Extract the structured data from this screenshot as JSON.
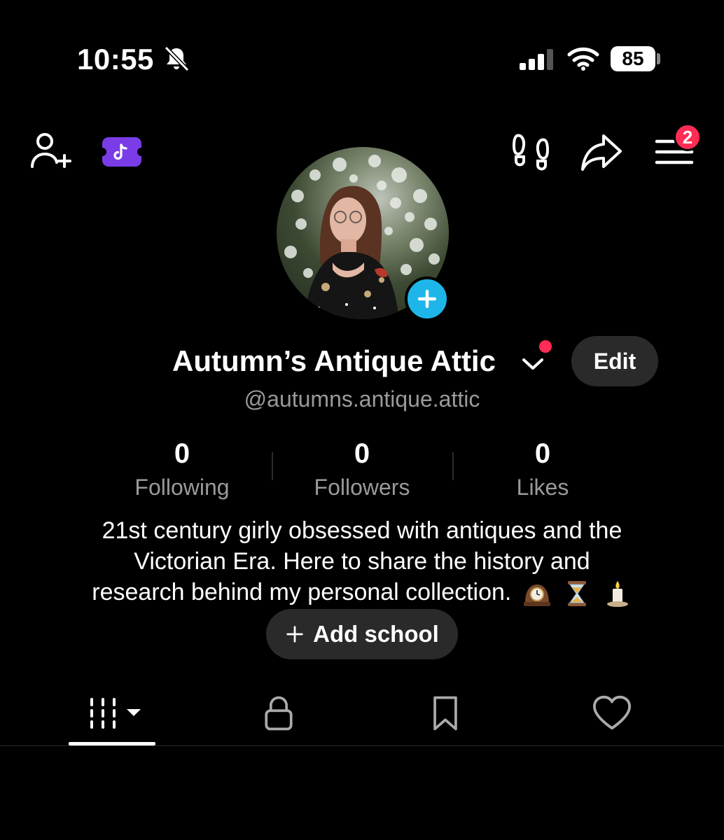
{
  "status_bar": {
    "time": "10:55",
    "battery": "85",
    "icons": [
      "bell-slash-icon",
      "signal-icon",
      "wifi-icon",
      "battery-icon"
    ]
  },
  "header": {
    "icons": [
      "add-friend-icon",
      "tiktok-ticket-icon",
      "footprints-icon",
      "share-icon",
      "menu-icon"
    ],
    "menu_badge": "2",
    "accent_color": "#7a3ce6",
    "badge_color": "#ff2d55"
  },
  "profile": {
    "name": "Autumn’s Antique Attic",
    "handle": "@autumns.antique.attic",
    "edit_label": "Edit",
    "add_avatar_color": "#1eb6e8"
  },
  "stats": [
    {
      "value": "0",
      "label": "Following"
    },
    {
      "value": "0",
      "label": "Followers"
    },
    {
      "value": "0",
      "label": "Likes"
    }
  ],
  "bio": {
    "line1": "21st century girly obsessed with antiques and the",
    "line2": "Victorian Era. Here to share the history and",
    "line3": "research behind my personal collection.",
    "emojis": [
      "mantel-clock-icon",
      "hourglass-icon",
      "candle-icon"
    ]
  },
  "school_button": {
    "label": "Add school"
  },
  "tabs": [
    {
      "name": "videos-grid-icon",
      "active": true
    },
    {
      "name": "lock-icon",
      "active": false
    },
    {
      "name": "bookmark-icon",
      "active": false
    },
    {
      "name": "heart-icon",
      "active": false
    }
  ]
}
